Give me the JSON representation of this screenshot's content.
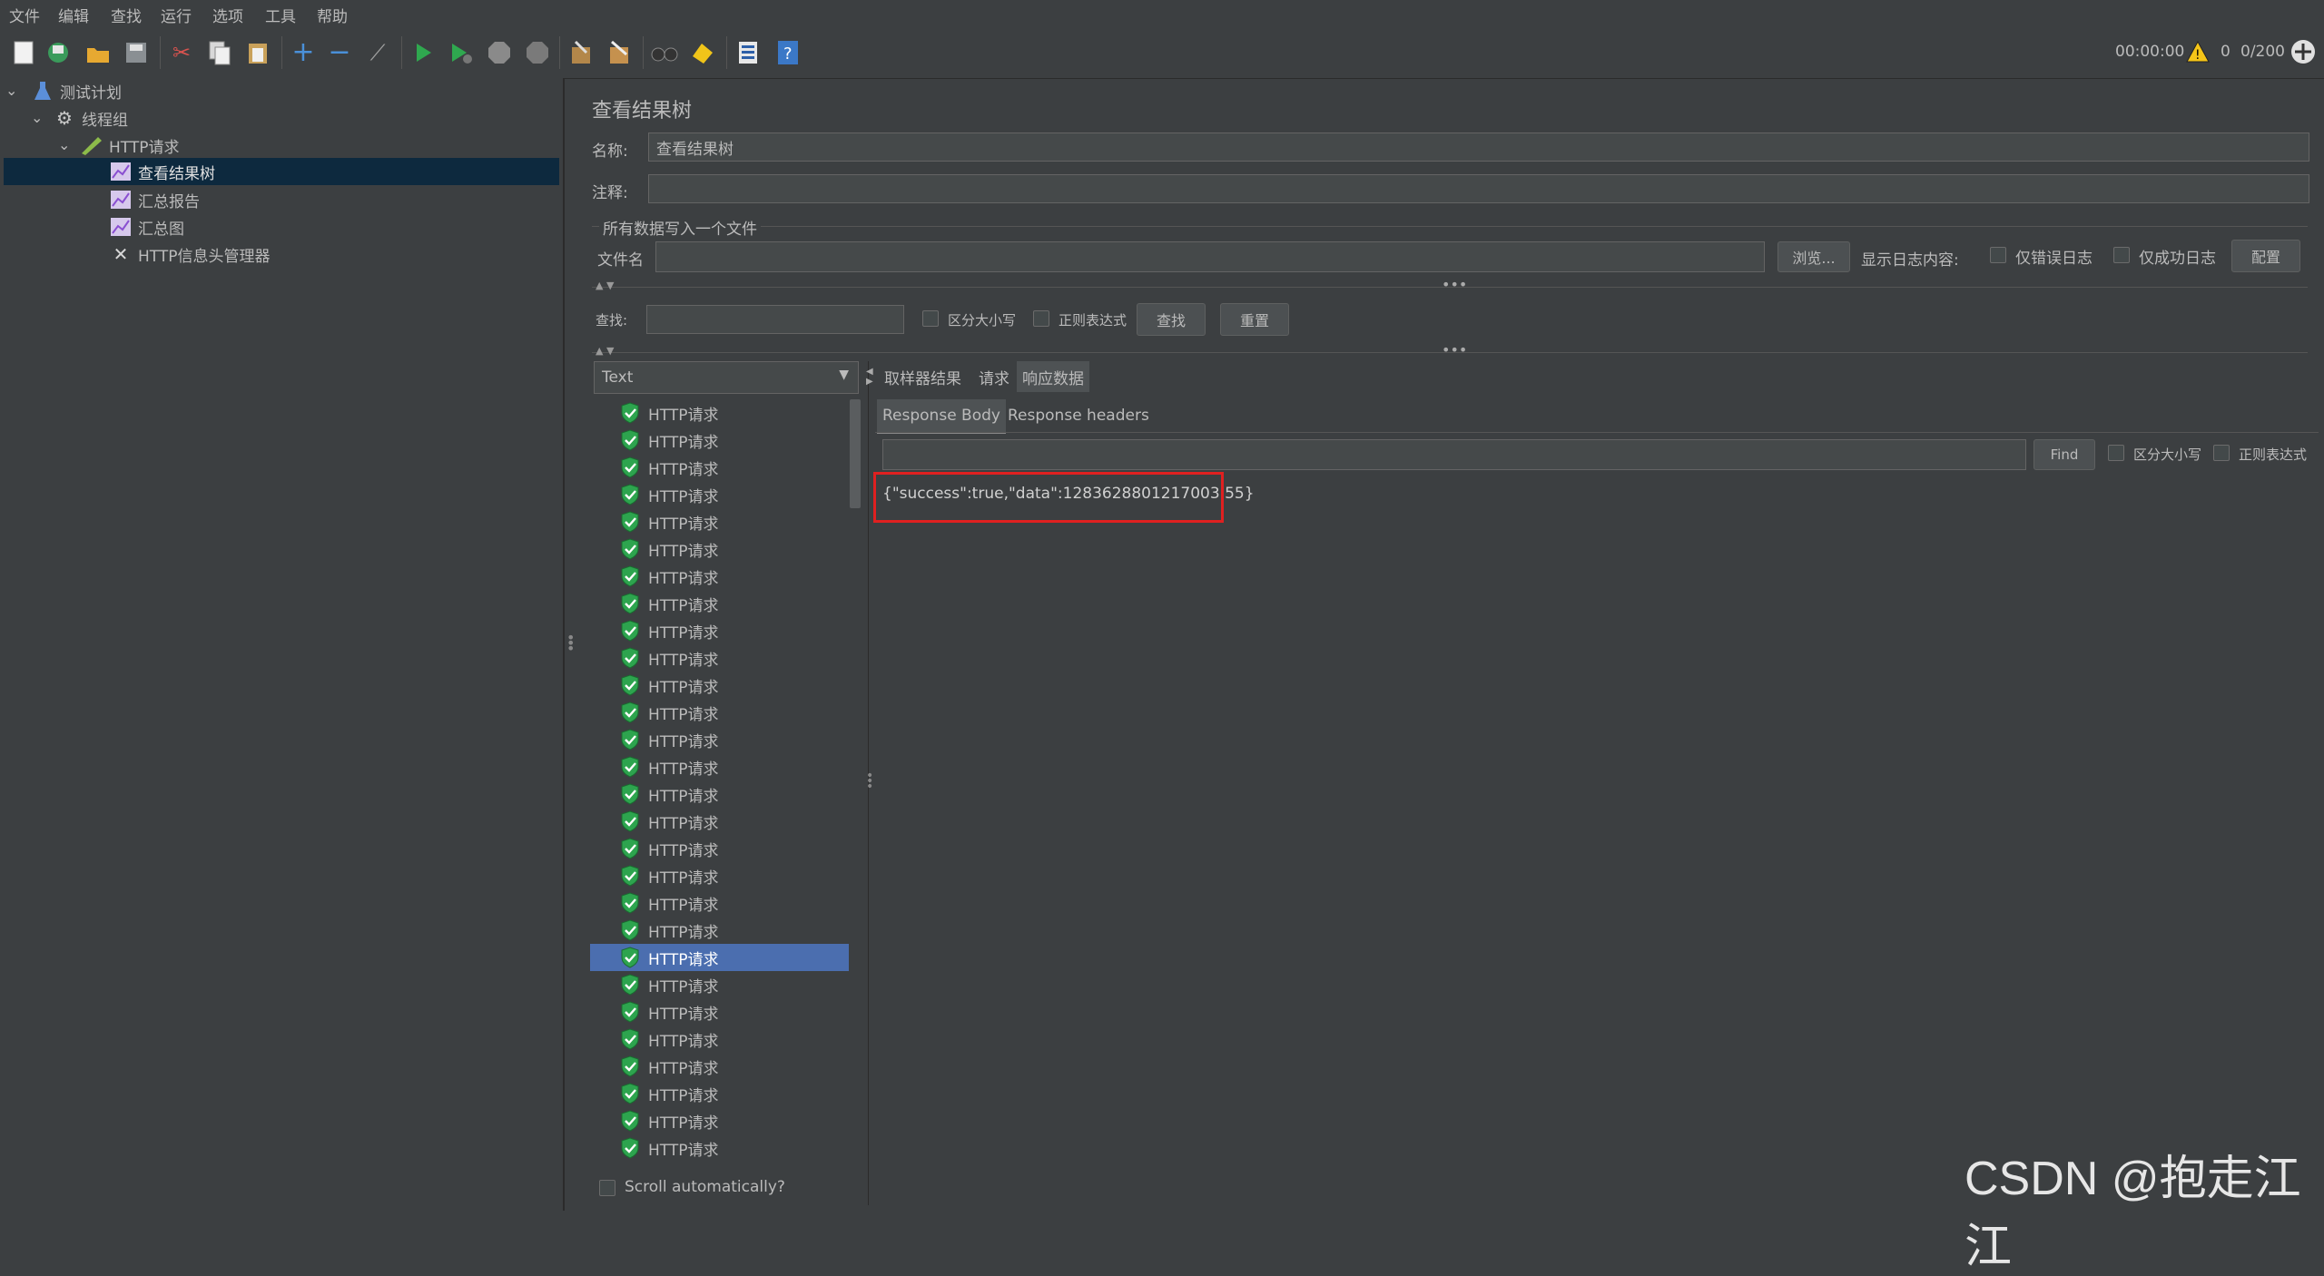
{
  "menu": [
    "文件",
    "编辑",
    "查找",
    "运行",
    "选项",
    "工具",
    "帮助"
  ],
  "status": {
    "timer": "00:00:00",
    "warnings": "0",
    "threads": "0/200"
  },
  "tree": {
    "plan": "测试计划",
    "thread_group": "线程组",
    "http_request": "HTTP请求",
    "view_results_tree": "查看结果树",
    "summary_report": "汇总报告",
    "summary_graph": "汇总图",
    "header_manager": "HTTP信息头管理器"
  },
  "panel": {
    "title": "查看结果树",
    "name_label": "名称:",
    "name_value": "查看结果树",
    "comment_label": "注释:",
    "file_group_label": "所有数据写入一个文件",
    "filename_label": "文件名",
    "browse_button": "浏览...",
    "log_display_label": "显示日志内容:",
    "errors_only": "仅错误日志",
    "success_only": "仅成功日志",
    "configure_button": "配置",
    "search_label": "查找:",
    "case_sensitive": "区分大小写",
    "regex": "正则表达式",
    "find_button": "查找",
    "reset_button": "重置"
  },
  "renderer": {
    "selected": "Text"
  },
  "results": {
    "item_label": "HTTP请求",
    "count": 28,
    "selected_index": 20,
    "scroll_auto": "Scroll automatically?"
  },
  "tabs": [
    "取样器结果",
    "请求",
    "响应数据"
  ],
  "active_tab": 2,
  "subtabs": [
    "Response Body",
    "Response headers"
  ],
  "response": {
    "find_button": "Find",
    "case_sensitive": "区分大小写",
    "regex": "正则表达式",
    "body": "{\"success\":true,\"data\":1283628801217003 55}"
  },
  "watermark": "CSDN @抱走江江",
  "colors": {
    "accent_selection": "#4b6eaf",
    "highlight_box": "#e02020",
    "background": "#3c3f41"
  }
}
